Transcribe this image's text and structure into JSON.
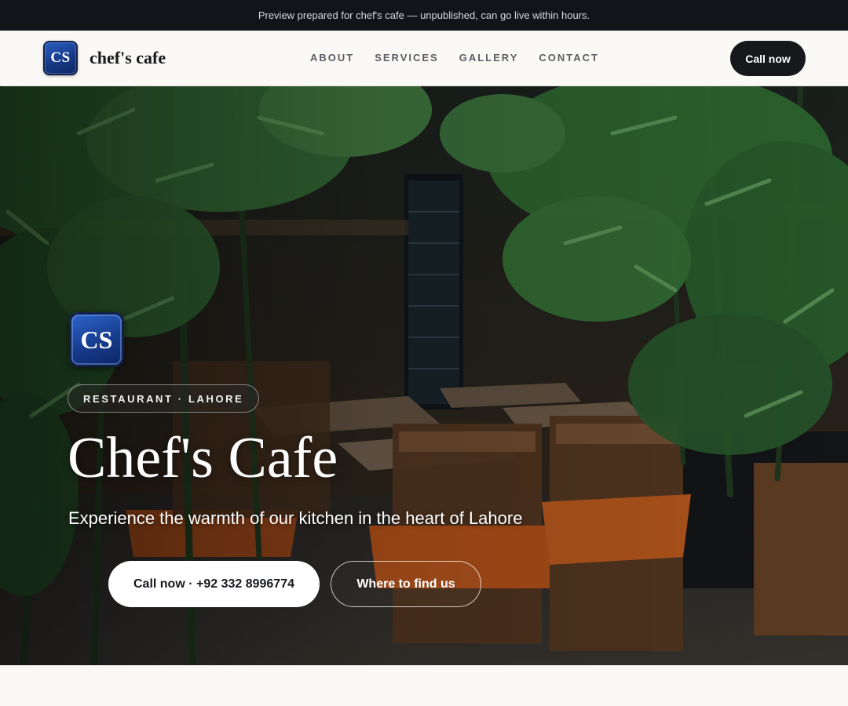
{
  "preview_banner": "Preview prepared for chef's cafe — unpublished, can go live within hours.",
  "brand": {
    "logo_initials": "CS",
    "name": "chef's cafe",
    "logo_colors": {
      "top": "#2c62c9",
      "bottom": "#0d2461"
    }
  },
  "nav": {
    "links": [
      "ABOUT",
      "SERVICES",
      "GALLERY",
      "CONTACT"
    ],
    "cta_label": "Call now"
  },
  "hero": {
    "logo_initials": "CS",
    "tag": "RESTAURANT · LAHORE",
    "title": "Chef's Cafe",
    "subtitle": "Experience the warmth of our kitchen in the heart of Lahore",
    "primary_button": "Call now · +92 332 8996774",
    "secondary_button": "Where to find us",
    "background_image": "restaurant-interior-with-wooden-chairs-and-bamboo-plants"
  },
  "colors": {
    "dark": "#16181c",
    "banner_bg": "#111418",
    "page_bg": "#faf9f6",
    "white": "#ffffff"
  }
}
